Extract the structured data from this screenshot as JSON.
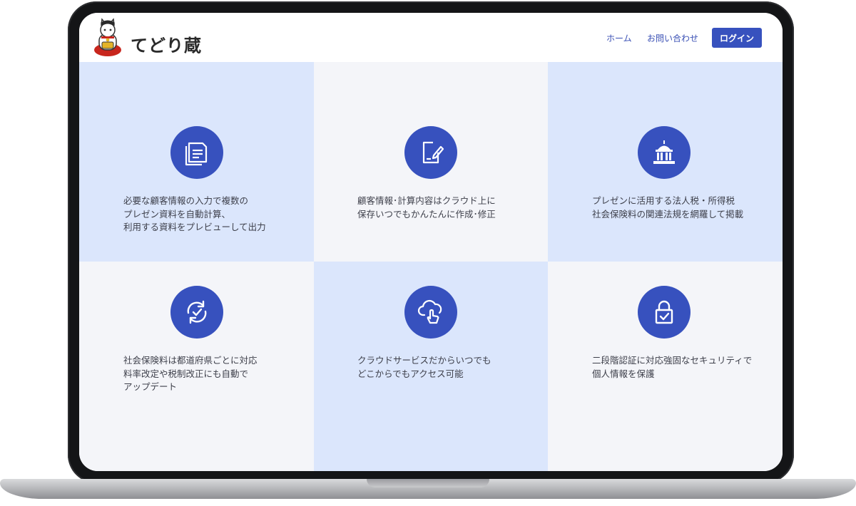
{
  "header": {
    "logo_text": "てどり蔵",
    "nav": [
      {
        "label": "ホーム"
      },
      {
        "label": "お問い合わせ"
      }
    ],
    "login_label": "ログイン"
  },
  "features": [
    {
      "icon": "document-icon",
      "text": "必要な顧客情報の入力で複数の\nプレゼン資料を自動計算、\n利用する資料をプレビューして出力"
    },
    {
      "icon": "edit-document-icon",
      "text": "顧客情報･計算内容はクラウド上に\n保存いつでもかんたんに作成･修正"
    },
    {
      "icon": "government-building-icon",
      "text": "プレゼンに活用する法人税・所得税\n社会保険料の関連法規を網羅して掲載"
    },
    {
      "icon": "auto-update-icon",
      "text": "社会保険料は都道府県ごとに対応\n料率改定や税制改正にも自動で\nアップデート"
    },
    {
      "icon": "cloud-access-icon",
      "text": "クラウドサービスだからいつでも\nどこからでもアクセス可能"
    },
    {
      "icon": "lock-icon",
      "text": "二段階認証に対応強固なセキュリティで\n個人情報を保護"
    }
  ],
  "colors": {
    "accent": "#3751be",
    "tile_blue": "#dbe6fc",
    "tile_gray": "#f4f5f9",
    "bezel": "#141517"
  }
}
